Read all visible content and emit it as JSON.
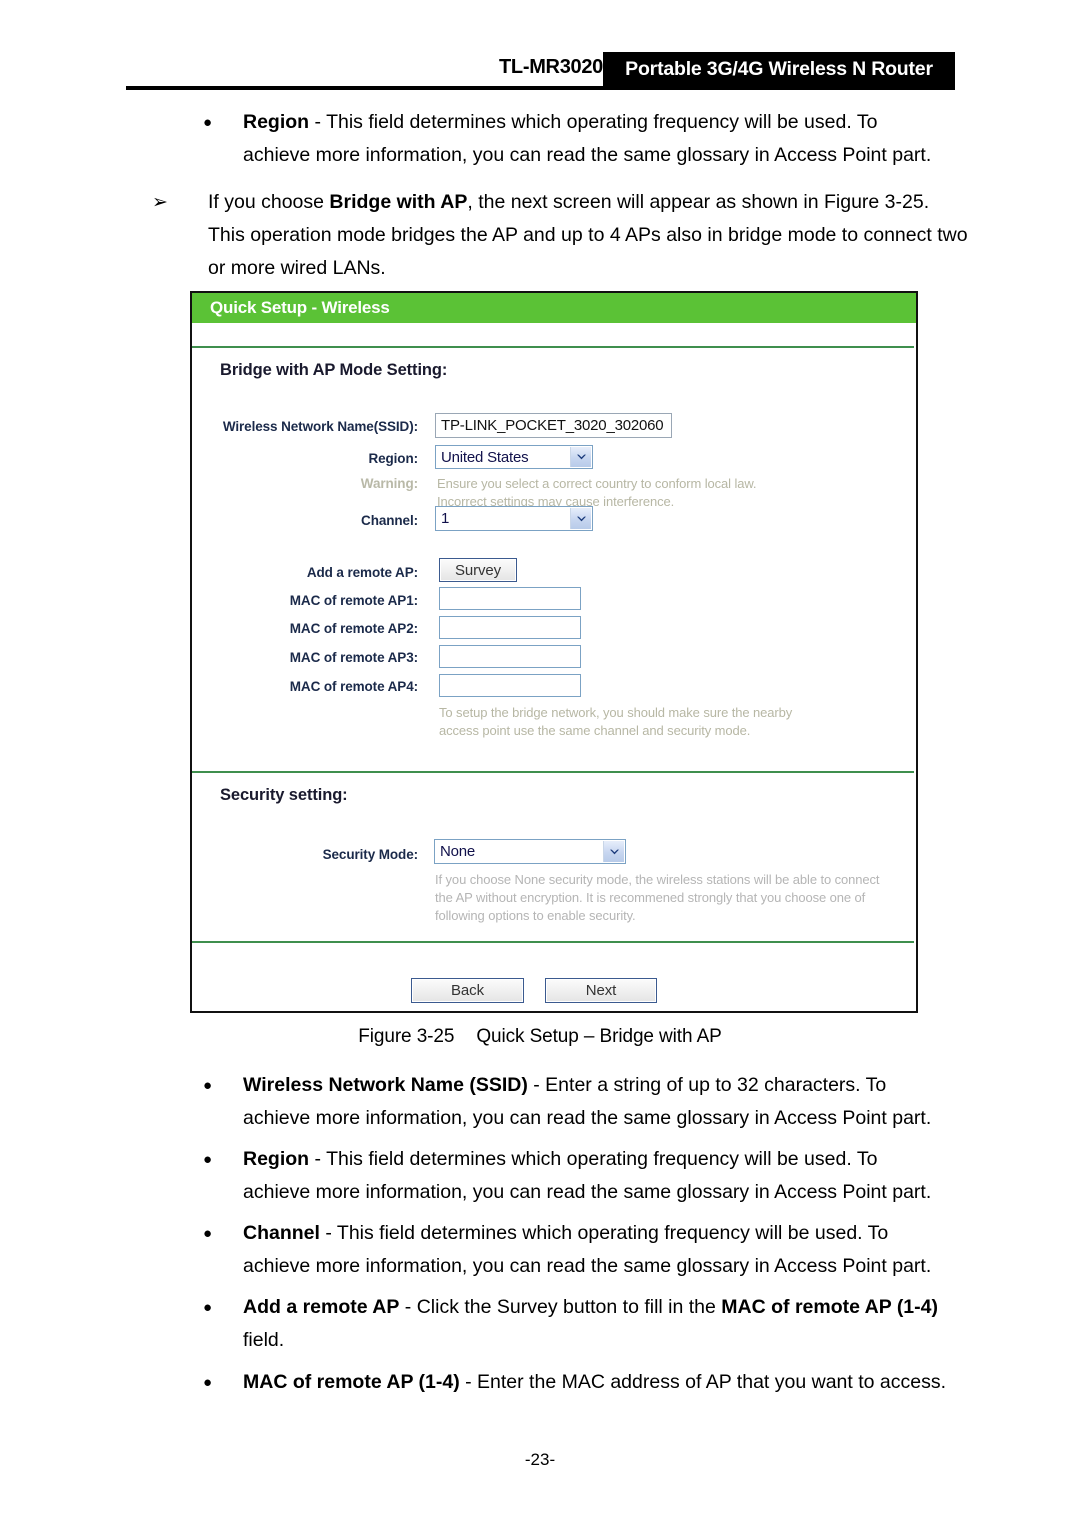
{
  "header": {
    "model": "TL-MR3020",
    "product": "Portable 3G/4G Wireless N Router"
  },
  "prose": {
    "region_top": {
      "marker": "●",
      "term": "Region",
      "line1_rest": " - This field determines which operating frequency will be used. To",
      "line2": "achieve more information, you can read the same glossary in Access Point part."
    },
    "bridge_intro": {
      "marker": "➢",
      "pre": "If you choose ",
      "term": "Bridge with AP",
      "post": ", the next screen will appear as shown in Figure 3-25.",
      "line2": "This operation mode bridges the AP and up to 4 APs also in bridge mode to connect two",
      "line3": "or more wired LANs."
    },
    "ssid_item": {
      "marker": "●",
      "term": "Wireless Network Name (SSID)",
      "line1_rest": " - Enter a string of up to 32 characters. To",
      "line2": "achieve more information, you can read the same glossary in Access Point part."
    },
    "region_item": {
      "marker": "●",
      "term": "Region",
      "line1_rest": " - This field determines which operating frequency will be used. To",
      "line2": "achieve more information, you can read the same glossary in Access Point part."
    },
    "channel_item": {
      "marker": "●",
      "term": "Channel",
      "line1_rest": " - This field determines which operating frequency will be used. To",
      "line2": "achieve more information, you can read the same glossary in Access Point part."
    },
    "addremote_item": {
      "marker": "●",
      "term": "Add a remote AP",
      "mid": " - Click the Survey button to fill in the ",
      "term2": "MAC of remote AP (1-4)",
      "line2": "field."
    },
    "mac_item": {
      "marker": "●",
      "term": "MAC of remote AP (1-4)",
      "rest": " - Enter the MAC address of AP that you want to access."
    }
  },
  "figure": {
    "label": "Figure 3-25",
    "caption": "Quick Setup – Bridge with AP"
  },
  "panel": {
    "title": "Quick Setup - Wireless",
    "section_mode": "Bridge with AP Mode Setting:",
    "section_security": "Security setting:",
    "labels": {
      "ssid": "Wireless Network Name(SSID):",
      "region": "Region:",
      "warning": "Warning:",
      "channel": "Channel:",
      "add_remote": "Add a remote AP:",
      "mac1": "MAC of remote AP1:",
      "mac2": "MAC of remote AP2:",
      "mac3": "MAC of remote AP3:",
      "mac4": "MAC of remote AP4:",
      "security_mode": "Security Mode:"
    },
    "values": {
      "ssid": "TP-LINK_POCKET_3020_302060",
      "region": "United States",
      "channel": "1",
      "security_mode": "None",
      "mac1": "",
      "mac2": "",
      "mac3": "",
      "mac4": ""
    },
    "notes": {
      "region_warning": "Ensure you select a correct country to conform local law.\nIncorrect settings may cause interference.",
      "bridge_hint": "To setup the bridge network, you should make sure the nearby\naccess point use the same channel and security mode.",
      "security_hint": "If you choose None security mode, the wireless stations will be able to connect\nthe AP without encryption. It is recommened strongly that you choose one of\nfollowing options to enable security."
    },
    "buttons": {
      "survey": "Survey",
      "back": "Back",
      "next": "Next"
    },
    "colors": {
      "title_bar_green": "#5bc236",
      "divider_green": "#3f8f4e",
      "label_navy": "#1b2a4a",
      "note_gray": "#b7b7a4"
    }
  },
  "page_number": "-23-"
}
